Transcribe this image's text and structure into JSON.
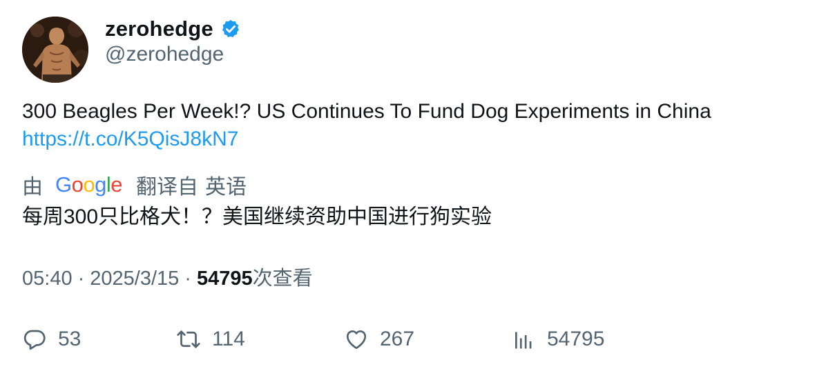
{
  "author": {
    "display_name": "zerohedge",
    "handle": "@zerohedge",
    "verified": true,
    "avatar_icon": "avatar-photo"
  },
  "tweet": {
    "text": "300 Beagles Per Week!? US Continues To Fund Dog Experiments in China",
    "link": "https://t.co/K5QisJ8kN7"
  },
  "translation": {
    "by_label": "由",
    "provider": "Google",
    "from_label": "翻译自",
    "language": "英语",
    "text": "每周300只比格犬！？美国继续资助中国进行狗实验"
  },
  "meta": {
    "time": "05:40",
    "separator": "·",
    "date": "2025/3/15",
    "views_count": "54795",
    "views_label": "次查看"
  },
  "actions": {
    "replies": "53",
    "retweets": "114",
    "likes": "267",
    "views": "54795"
  },
  "colors": {
    "link": "#1d9bf0",
    "secondary_text": "#536471",
    "primary_text": "#0f1419",
    "verified_badge": "#1d9bf0"
  }
}
